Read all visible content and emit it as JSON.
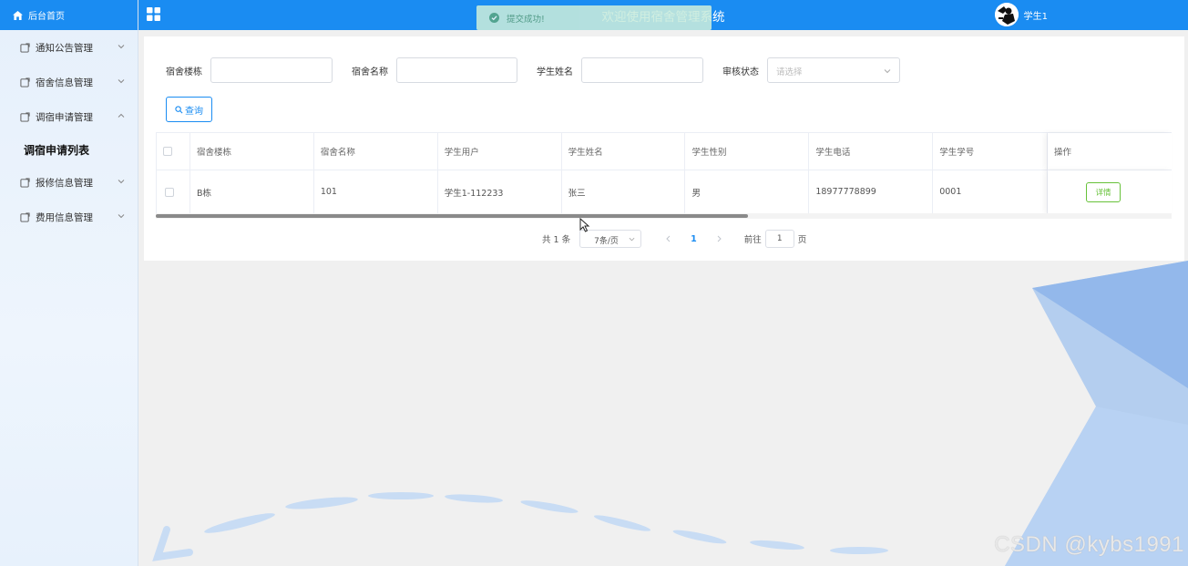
{
  "sidebar": {
    "home_label": "后台首页",
    "items": [
      {
        "label": "通知公告管理",
        "expanded": false
      },
      {
        "label": "宿舍信息管理",
        "expanded": false
      },
      {
        "label": "调宿申请管理",
        "expanded": true
      },
      {
        "label": "报修信息管理",
        "expanded": false
      },
      {
        "label": "费用信息管理",
        "expanded": false
      }
    ],
    "submenu_active": "调宿申请列表"
  },
  "header": {
    "title": "欢迎使用宿舍管理系统",
    "user_name": "学生1"
  },
  "toast": {
    "message": "提交成功!"
  },
  "search": {
    "building_label": "宿舍楼栋",
    "building_value": "",
    "room_label": "宿舍名称",
    "room_value": "",
    "student_label": "学生姓名",
    "student_value": "",
    "status_label": "审核状态",
    "status_placeholder": "请选择",
    "query_label": "查询"
  },
  "table": {
    "headers": [
      "宿舍楼栋",
      "宿舍名称",
      "学生用户",
      "学生姓名",
      "学生性别",
      "学生电话",
      "学生学号",
      "操作"
    ],
    "rows": [
      {
        "building": "B栋",
        "room": "101",
        "user": "学生1-112233",
        "name": "张三",
        "gender": "男",
        "phone": "18977778899",
        "student_no": "0001",
        "action": "详情"
      }
    ]
  },
  "pagination": {
    "total_text": "共 1 条",
    "page_size": "7条/页",
    "current_page": "1",
    "goto_prefix": "前往",
    "goto_value": "1",
    "goto_suffix": "页"
  },
  "watermark": "CSDN @kybs1991",
  "colors": {
    "primary": "#1a8cf2",
    "success": "#67c23a",
    "toast_bg": "#c9ecdc"
  }
}
